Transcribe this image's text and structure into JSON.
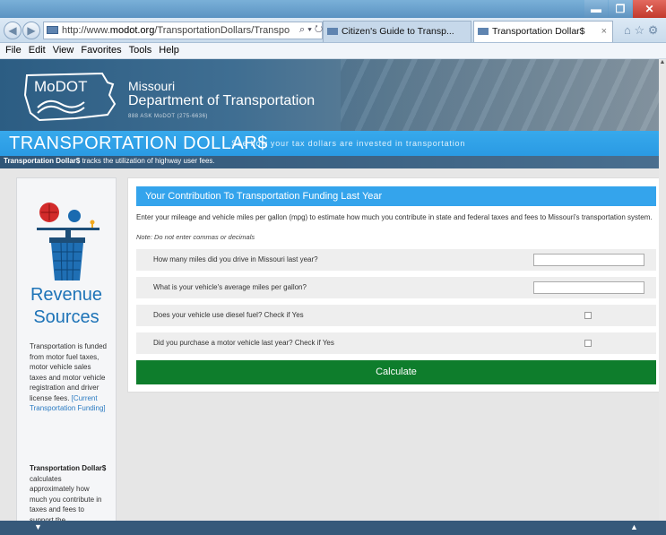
{
  "browser": {
    "url_prefix": "http://www.",
    "url_host": "modot.org",
    "url_path": "/TransportationDollars/Transpo",
    "addr_icons": "⌕ ▾ ↻",
    "tabs": [
      {
        "label": "Citizen's Guide to Transp..."
      },
      {
        "label": "Transportation Dollar$"
      }
    ],
    "tab_close": "×",
    "window_buttons": {
      "minimize": "▬",
      "maximize": "❐",
      "close": "✕"
    },
    "nav": {
      "back": "◀",
      "forward": "▶"
    },
    "toolbar_icons": "⌂ ☆ ⚙",
    "menu": [
      "File",
      "Edit",
      "View",
      "Favorites",
      "Tools",
      "Help"
    ]
  },
  "header": {
    "logo_text": "MoDOT",
    "state": "Missouri",
    "department": "Department of Transportation",
    "phone": "888 ASK MoDOT (275-6636)"
  },
  "banner": {
    "title": "TRANSPORTATION DOLLAR$",
    "tagline": "See how your tax dollars are invested in transportation"
  },
  "strip": {
    "bold": "Transportation Dollar$",
    "text": " tracks the utilization of highway user fees."
  },
  "sidebar": {
    "title_line1": "Revenue",
    "title_line2": "Sources",
    "description": "Transportation is funded from motor fuel taxes, motor vehicle sales taxes and motor vehicle registration and driver license fees.",
    "link": "[Current Transportation Funding]",
    "desc2_bold": "Transportation Dollar$",
    "desc2_text": " calculates approximately how much you contribute in taxes and fees to support the transportation system"
  },
  "form": {
    "title": "Your Contribution To Transportation Funding Last Year",
    "intro": "Enter your mileage and vehicle miles per gallon (mpg) to estimate how much you contribute in state and federal taxes and fees to Missouri's transportation system.",
    "note": "Note: Do not enter commas or decimals",
    "questions": [
      {
        "label": "How many miles did you drive in Missouri last year?",
        "value": ""
      },
      {
        "label": "What is your vehicle's average miles per gallon?",
        "value": ""
      },
      {
        "label": "Does your vehicle use diesel fuel? Check if Yes"
      },
      {
        "label": "Did you purchase a motor vehicle last year? Check if Yes"
      }
    ],
    "calculate_label": "Calculate"
  },
  "bottom": {
    "down_arrow": "▼",
    "up_arrow": "▲"
  },
  "colors": {
    "banner_blue": "#2a9ae3",
    "header_blue": "#34a4ec",
    "calculate_green": "#0e7d2c",
    "sidebar_title": "#1d73b7"
  },
  "icons": [
    "back-icon",
    "forward-icon",
    "search-icon",
    "refresh-icon",
    "home-icon",
    "star-icon",
    "gear-icon",
    "revenue-icon"
  ]
}
